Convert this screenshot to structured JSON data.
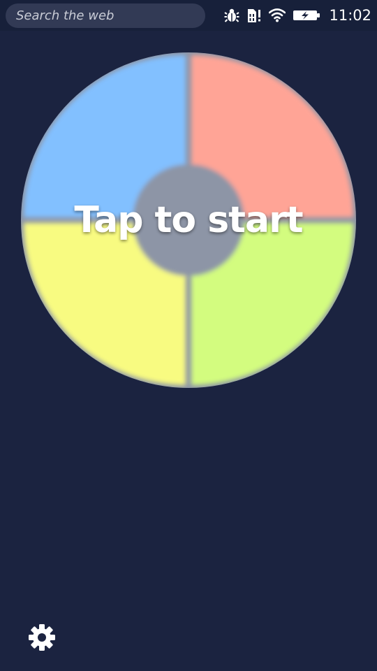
{
  "status_bar": {
    "search_placeholder": "Search the web",
    "time": "11:02",
    "icons": [
      "bug-icon",
      "sim-card-alert-icon",
      "wifi-icon",
      "battery-charging-icon"
    ]
  },
  "game": {
    "start_label": "Tap to start",
    "pads": [
      {
        "name": "top-left",
        "color": "#82c0ff"
      },
      {
        "name": "top-right",
        "color": "#ffa496"
      },
      {
        "name": "bottom-left",
        "color": "#f8fb81"
      },
      {
        "name": "bottom-right",
        "color": "#d3fc7f"
      }
    ],
    "center_color": "#8d95a6",
    "rim_color": "#8d95a6"
  },
  "footer": {
    "settings_icon": "gear-icon"
  }
}
